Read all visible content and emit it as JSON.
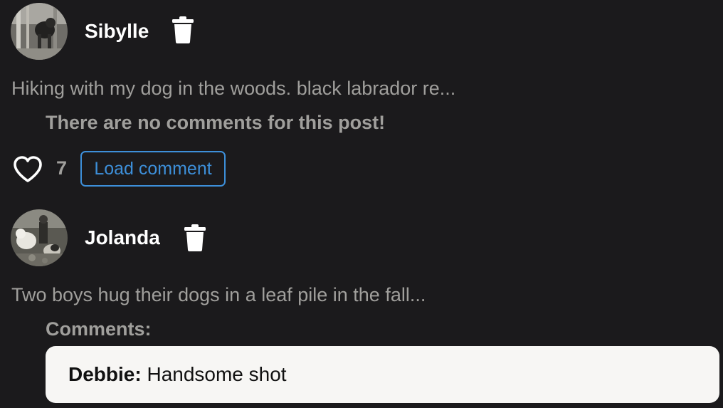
{
  "posts": [
    {
      "username": "Sibylle",
      "caption": "Hiking with my dog in the woods. black labrador re...",
      "comments_notice": "There are no comments for this post!",
      "likes": "7",
      "load_comment_label": "Load comment",
      "avatar_icon": "avatar-photo-dog-woods",
      "delete_icon": "trash-icon",
      "like_icon": "heart-outline-icon"
    },
    {
      "username": "Jolanda",
      "caption": "Two boys hug their dogs in a leaf pile in the fall...",
      "comments_label": "Comments:",
      "comments": [
        {
          "author": "Debbie:",
          "text": " Handsome shot"
        }
      ],
      "avatar_icon": "avatar-photo-boys-dogs",
      "delete_icon": "trash-icon"
    }
  ],
  "colors": {
    "background": "#1b1a1c",
    "username": "#ffffff",
    "muted_text": "#a09f9c",
    "accent_blue": "#3d8fd9",
    "comment_card": "#f7f6f4",
    "comment_text": "#111111"
  }
}
